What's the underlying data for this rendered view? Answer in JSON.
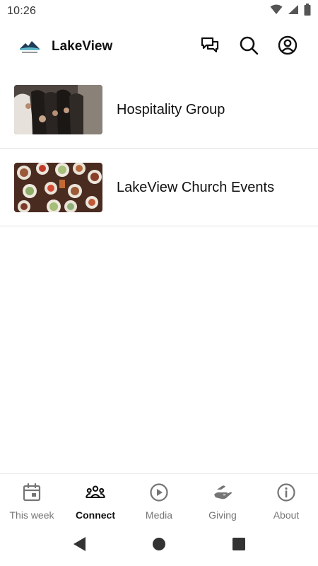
{
  "status_bar": {
    "time": "10:26",
    "icons": [
      "wifi-icon",
      "signal-icon",
      "battery-icon"
    ]
  },
  "app_bar": {
    "title": "LakeView",
    "actions": [
      "chat-icon",
      "search-icon",
      "account-icon"
    ]
  },
  "list": {
    "items": [
      {
        "label": "Hospitality Group",
        "thumbnail": "people-gathering-photo"
      },
      {
        "label": "LakeView Church Events",
        "thumbnail": "food-table-photo"
      }
    ]
  },
  "bottom_nav": {
    "active": "Connect",
    "items": [
      {
        "label": "This week",
        "icon": "calendar-icon"
      },
      {
        "label": "Connect",
        "icon": "group-icon"
      },
      {
        "label": "Media",
        "icon": "play-circle-icon"
      },
      {
        "label": "Giving",
        "icon": "hand-icon"
      },
      {
        "label": "About",
        "icon": "info-icon"
      }
    ]
  },
  "colors": {
    "text_primary": "#111111",
    "text_secondary": "#757575",
    "divider": "#e3e3e3",
    "background": "#ffffff"
  }
}
